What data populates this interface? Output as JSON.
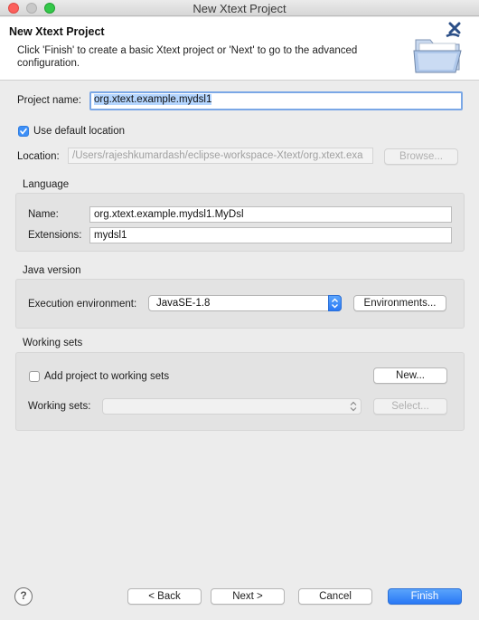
{
  "window": {
    "title": "New Xtext Project"
  },
  "banner": {
    "title": "New Xtext Project",
    "description": "Click 'Finish' to create a basic Xtext project or 'Next' to go to the advanced configuration."
  },
  "project": {
    "name_label": "Project name:",
    "name_value": "org.xtext.example.mydsl1",
    "use_default_label": "Use default location",
    "use_default_checked": true,
    "location_label": "Location:",
    "location_value": "/Users/rajeshkumardash/eclipse-workspace-Xtext/org.xtext.exa",
    "browse_label": "Browse..."
  },
  "language": {
    "group_title": "Language",
    "name_label": "Name:",
    "name_value": "org.xtext.example.mydsl1.MyDsl",
    "extensions_label": "Extensions:",
    "extensions_value": "mydsl1"
  },
  "java": {
    "group_title": "Java version",
    "env_label": "Execution environment:",
    "env_value": "JavaSE-1.8",
    "environments_button": "Environments..."
  },
  "working_sets": {
    "group_title": "Working sets",
    "add_label": "Add project to working sets",
    "add_checked": false,
    "new_button": "New...",
    "sets_label": "Working sets:",
    "sets_value": "",
    "select_button": "Select..."
  },
  "footer": {
    "help_icon": "question-mark-icon",
    "back": "< Back",
    "next": "Next >",
    "cancel": "Cancel",
    "finish": "Finish"
  },
  "colors": {
    "primary_button": "#2978f5",
    "checkbox_checked": "#3d8ff7",
    "focus_ring": "#7aa7e6"
  }
}
